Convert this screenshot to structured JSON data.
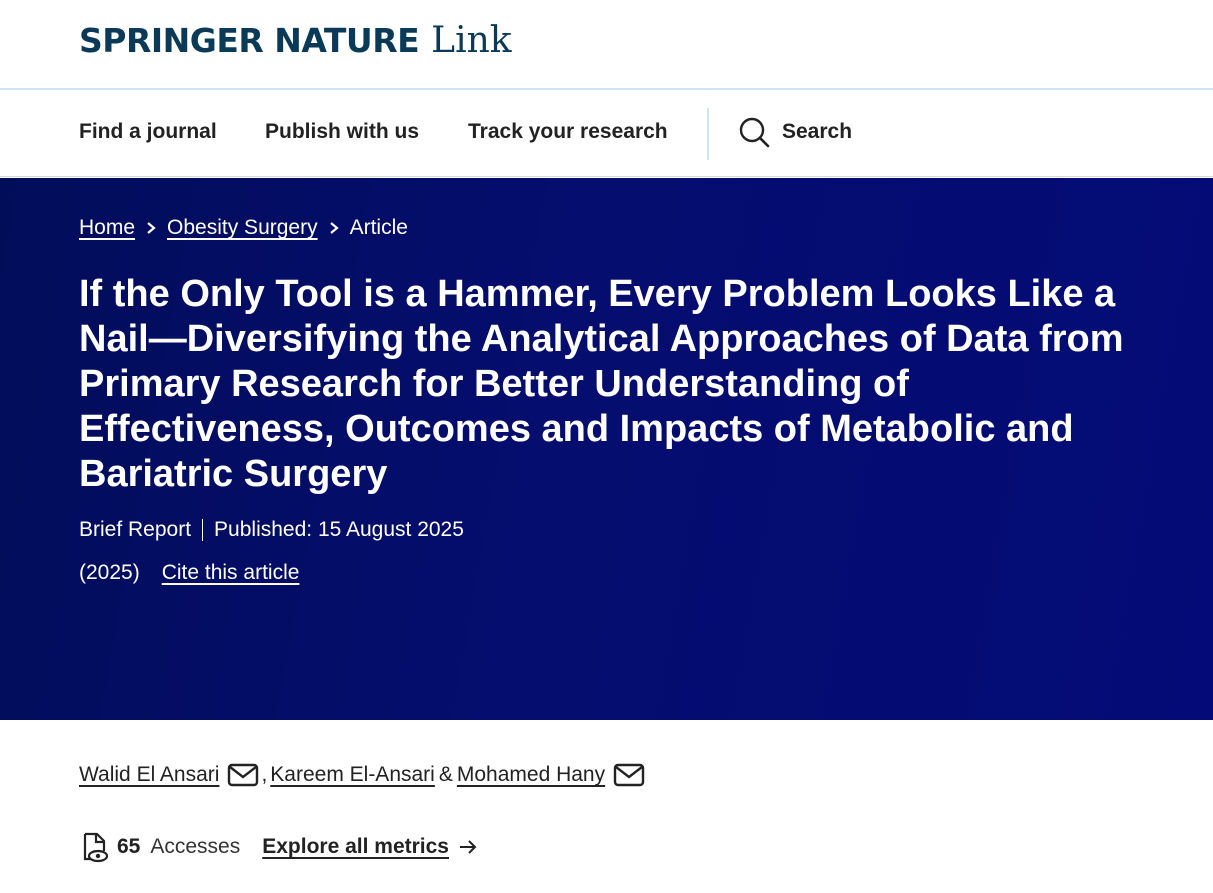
{
  "header": {
    "brand": "SPRINGER NATURE",
    "brand_suffix": "Link"
  },
  "nav": {
    "items": [
      {
        "label": "Find a journal"
      },
      {
        "label": "Publish with us"
      },
      {
        "label": "Track your research"
      }
    ],
    "search_label": "Search"
  },
  "breadcrumb": {
    "home": "Home",
    "journal": "Obesity Surgery",
    "current": "Article"
  },
  "article": {
    "title": "If the Only Tool is a Hammer, Every Problem Looks Like a Nail—Diversifying the Analytical Approaches of Data from Primary Research for Better Understanding of Effectiveness, Outcomes and Impacts of Metabolic and Bariatric Surgery",
    "type": "Brief Report",
    "published": "Published: 15 August 2025",
    "year": "(2025)",
    "cite_label": "Cite this article"
  },
  "authors": [
    {
      "name": "Walid El Ansari",
      "has_email": true
    },
    {
      "name": "Kareem El-Ansari",
      "has_email": false
    },
    {
      "name": "Mohamed Hany",
      "has_email": true
    }
  ],
  "author_separators": {
    "comma": ",",
    "amp": "&"
  },
  "metrics": {
    "accesses_count": "65",
    "accesses_label": "Accesses",
    "explore_label": "Explore all metrics"
  },
  "colors": {
    "brand": "#0a3a57",
    "hero_bg": "#050d6e",
    "divider": "#cfe3f2"
  }
}
